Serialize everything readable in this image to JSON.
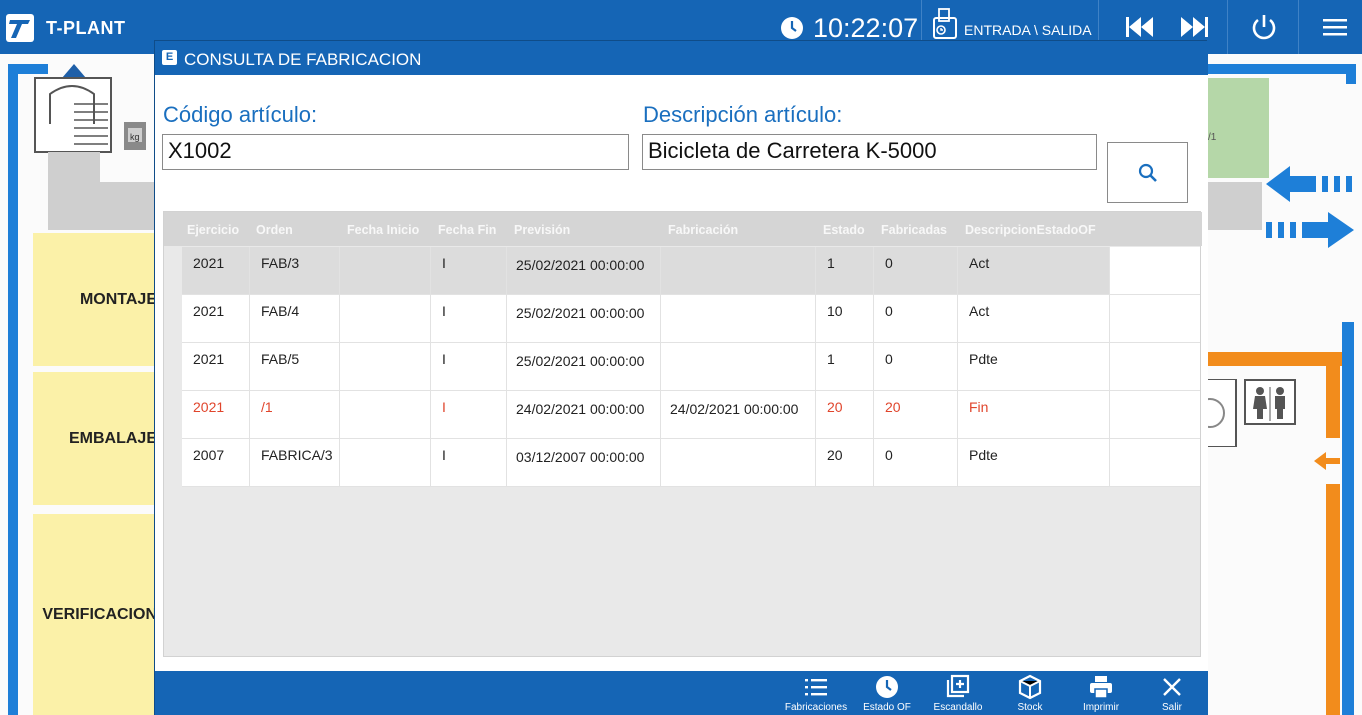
{
  "topbar": {
    "app_title": "T-PLANT",
    "time": "10:22:07",
    "entry_label": "ENTRADA \\ SALIDA"
  },
  "stations": [
    "MONTAJE",
    "EMBALAJE",
    "VERIFICACION"
  ],
  "green_box_label": "/1",
  "modal": {
    "title": "CONSULTA DE FABRICACION",
    "code_label": "Código artículo:",
    "code_value": "X1002",
    "desc_label": "Descripción artículo:",
    "desc_value": "Bicicleta de Carretera K-5000",
    "columns": [
      "Ejercicio",
      "Orden",
      "Fecha Inicio",
      "Fecha Fin",
      "Previsión",
      "Fabricación",
      "Estado",
      "Fabricadas",
      "DescripcionEstadoOF"
    ],
    "rows": [
      [
        "2021",
        "FAB/3",
        "",
        "I",
        "25/02/2021 00:00:00",
        "",
        "1",
        "0",
        "Act"
      ],
      [
        "2021",
        "FAB/4",
        "",
        "I",
        "25/02/2021 00:00:00",
        "",
        "10",
        "0",
        "Act"
      ],
      [
        "2021",
        "FAB/5",
        "",
        "I",
        "25/02/2021 00:00:00",
        "",
        "1",
        "0",
        "Pdte"
      ],
      [
        "2021",
        "/1",
        "",
        "I",
        "24/02/2021 00:00:00",
        "24/02/2021 00:00:00",
        "20",
        "20",
        "Fin"
      ],
      [
        "2007",
        "FABRICA/3",
        "",
        "I",
        "03/12/2007 00:00:00",
        "",
        "20",
        "0",
        "Pdte"
      ]
    ],
    "footer_buttons": [
      "Fabricaciones",
      "Estado OF",
      "Escandallo",
      "Stock",
      "Imprimir",
      "Salir"
    ]
  },
  "colors": {
    "brand_blue": "#1565b5",
    "finished_red": "#e0452c",
    "station_yellow": "#fbf1a8"
  }
}
